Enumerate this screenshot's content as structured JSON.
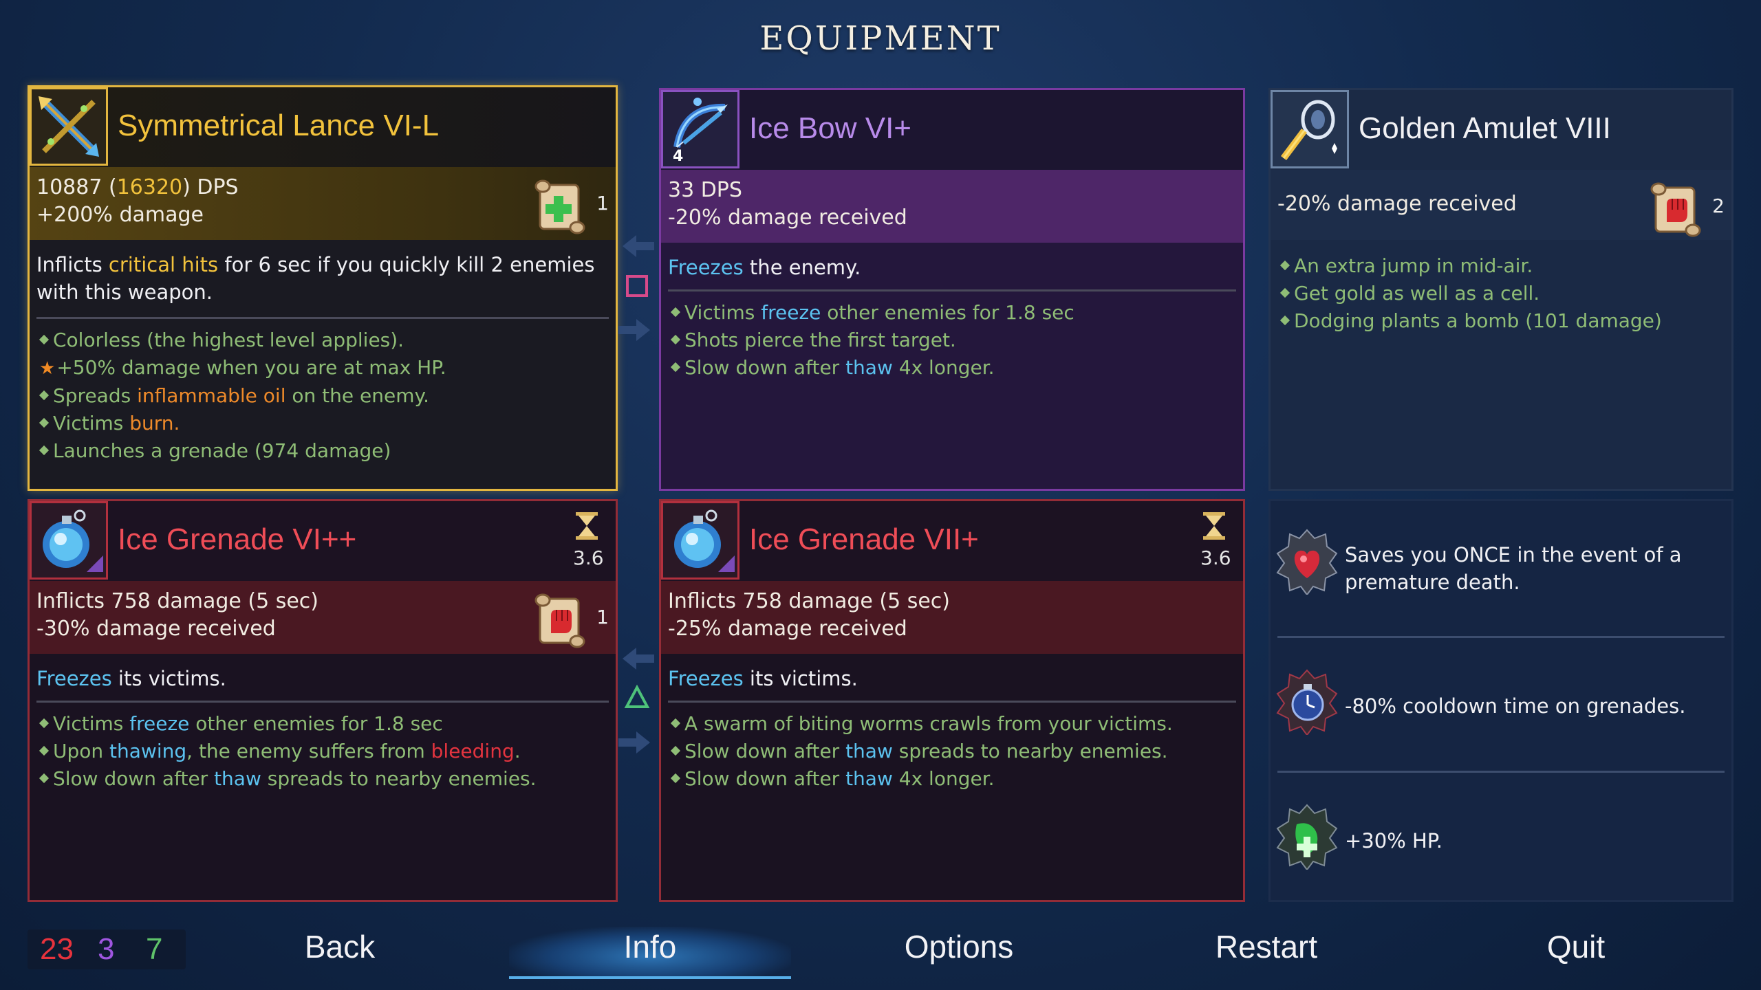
{
  "screen_title": "EQUIPMENT",
  "weapon1": {
    "name": "Symmetrical Lance VI-L",
    "dps_base": "10887 (",
    "dps_high": "16320",
    "dps_suffix": ") DPS",
    "bonus": "+200% damage",
    "scroll_count": "1",
    "main_pre": "Inflicts ",
    "main_hl": "critical hits",
    "main_post": " for 6 sec if you quickly kill 2 enemies with this weapon.",
    "affixes": {
      "a1": "Colorless (the highest level applies).",
      "a2": "+50% damage when you are at max HP.",
      "a3_pre": "Spreads ",
      "a3_hl": "inflammable oil",
      "a3_post": " on the enemy.",
      "a4_pre": "Victims ",
      "a4_hl": "burn.",
      "a5": "Launches a grenade (974 damage)"
    }
  },
  "weapon2": {
    "name": "Ice Bow VI+",
    "level_badge": "4",
    "stat1": "33 DPS",
    "stat2": "-20% damage received",
    "main_hl": "Freezes",
    "main_post": " the enemy.",
    "affixes": {
      "a1_pre": "Victims ",
      "a1_hl": "freeze",
      "a1_post": " other enemies for 1.8 sec",
      "a2": "Shots pierce the first target.",
      "a3_pre": "Slow down after ",
      "a3_hl": "thaw",
      "a3_post": " 4x longer."
    }
  },
  "amulet": {
    "name": "Golden Amulet VIII",
    "stat1": "-20% damage received",
    "scroll_count": "2",
    "affixes": {
      "a1": "An extra jump in mid-air.",
      "a2": "Get gold as well as a cell.",
      "a3": "Dodging plants a bomb (101 damage)"
    }
  },
  "skill1": {
    "name": "Ice Grenade VI++",
    "cooldown": "3.6",
    "stat1": "Inflicts 758 damage (5 sec)",
    "stat2": "-30% damage received",
    "scroll_count": "1",
    "main_hl": "Freezes",
    "main_post": " its victims.",
    "affixes": {
      "a1_pre": "Victims ",
      "a1_hl": "freeze",
      "a1_post": " other enemies for 1.8 sec",
      "a2_pre": "Upon ",
      "a2_hl": "thawing",
      "a2_mid": ", the enemy suffers from ",
      "a2_hl2": "bleeding",
      "a2_post": ".",
      "a3_pre": "Slow down after ",
      "a3_hl": "thaw",
      "a3_post": " spreads to nearby enemies."
    }
  },
  "skill2": {
    "name": "Ice Grenade VII+",
    "cooldown": "3.6",
    "stat1": "Inflicts 758 damage (5 sec)",
    "stat2": "-25% damage received",
    "main_hl": "Freezes",
    "main_post": " its victims.",
    "affixes": {
      "a1": "A swarm of biting worms crawls from your victims.",
      "a2_pre": "Slow down after ",
      "a2_hl": "thaw",
      "a2_post": " spreads to nearby enemies.",
      "a3_pre": "Slow down after ",
      "a3_hl": "thaw",
      "a3_post": " 4x longer."
    }
  },
  "mutations": {
    "m1": "Saves you ONCE in the event of a premature death.",
    "m2": "-80% cooldown time on grenades.",
    "m3": "+30% HP."
  },
  "scroll_counts": {
    "brutality": "23",
    "tactics": "3",
    "survival": "7"
  },
  "menu": {
    "back": "Back",
    "info": "Info",
    "options": "Options",
    "restart": "Restart",
    "quit": "Quit"
  },
  "colors": {
    "brutality": "#e8333d",
    "tactics": "#9f56e0",
    "survival": "#5fc36a",
    "gold_border": "#e3b640",
    "purple_border": "#7a3aa0",
    "red_border": "#932c37",
    "ice_text": "#5cc3f0",
    "affix_green": "#8fbd76",
    "highlight_orange": "#ee8a2a"
  },
  "icons": [
    "lance-icon",
    "ice-bow-icon",
    "golden-amulet-icon",
    "ice-grenade-icon",
    "hourglass-icon",
    "scroll-survival-icon",
    "scroll-brutality-icon",
    "heart-mutation-icon",
    "clock-mutation-icon",
    "hp-mutation-icon",
    "swap-arrows-icon",
    "square-button-icon",
    "triangle-button-icon",
    "star-icon"
  ]
}
